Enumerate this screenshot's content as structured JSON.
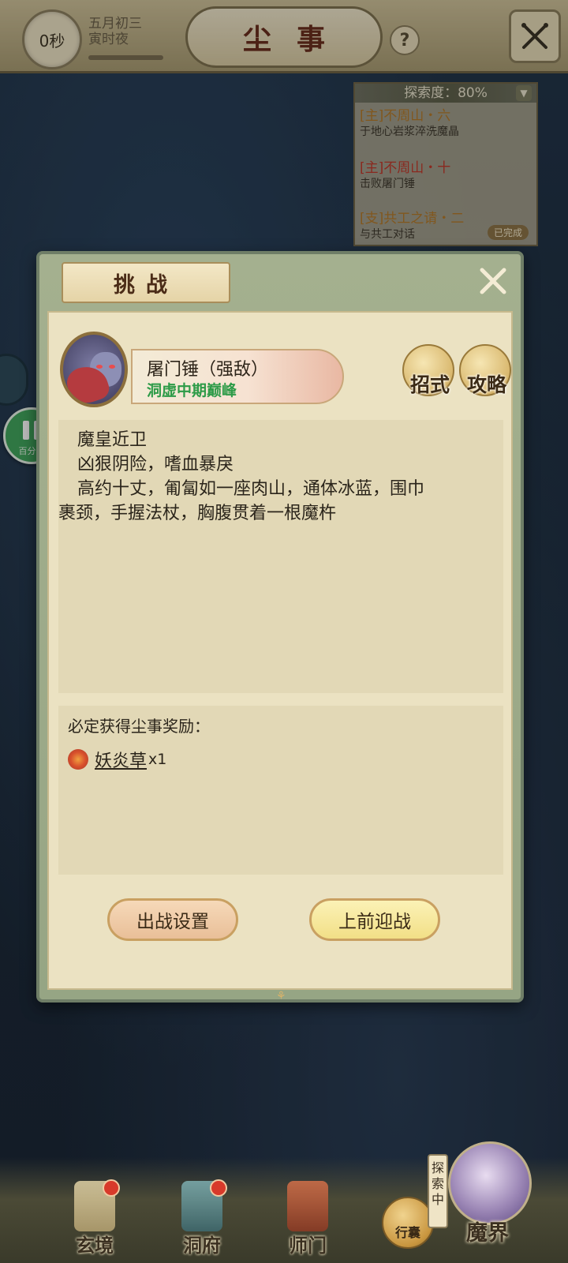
{
  "top_bar": {
    "timer": "0秒",
    "date_line1": "五月初三",
    "date_line2": "寅时夜",
    "title": "尘事",
    "help": "?"
  },
  "quest_panel": {
    "header": "探索度：80%",
    "items": [
      {
        "tag": "[主]不周山・六",
        "tag_color": "#b3792a",
        "desc": "于地心岩浆淬洗魔晶"
      },
      {
        "tag": "[主]不周山・十",
        "tag_color": "#c0392b",
        "desc": "击败屠门锤"
      },
      {
        "tag": "[支]共工之请・二",
        "tag_color": "#b3792a",
        "desc": "与共工对话",
        "badge": "已完成"
      }
    ]
  },
  "pause_widget": {
    "label": "百分网"
  },
  "dialog": {
    "title": "挑战",
    "boss": {
      "name": "屠门锤（强敌）",
      "realm": "洞虚中期巅峰",
      "realm_color": "#2d9b48"
    },
    "buttons_round": {
      "moves": "招式",
      "guide": "攻略"
    },
    "description": [
      "魔皇近卫",
      "凶狠阴险，嗜血暴戾",
      "高约十丈，匍匐如一座肉山，通体冰蓝，围巾",
      "裹颈，手握法杖，胸腹贯着一根魔杵"
    ],
    "reward": {
      "title": "必定获得尘事奖励：",
      "item_name": "妖炎草",
      "item_count": "x1"
    },
    "actions": {
      "setup": "出战设置",
      "fight": "上前迎战"
    }
  },
  "bottom_nav": {
    "items": [
      {
        "label": "玄境"
      },
      {
        "label": "洞府"
      },
      {
        "label": "师门"
      }
    ],
    "bag": "行囊",
    "explore_tag": "探索中",
    "current": "魔界"
  }
}
